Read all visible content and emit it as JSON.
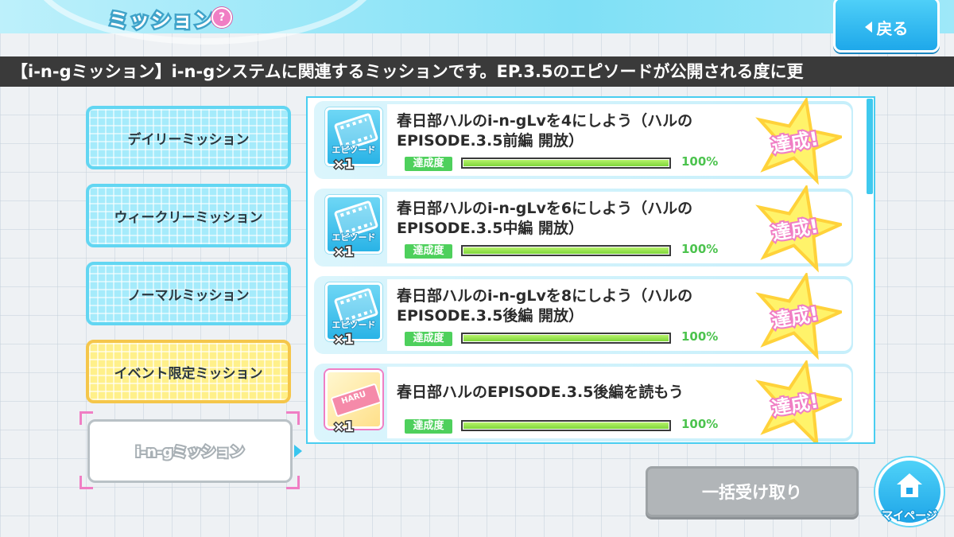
{
  "header": {
    "title": "ミッション",
    "help_label": "?",
    "back_label": "戻る"
  },
  "banner_text": "【i-n-gミッション】i-n-gシステムに関連するミッションです。EP.3.5のエピソードが公開される度に更",
  "tabs": [
    {
      "label": "デイリーミッション",
      "style": "blue"
    },
    {
      "label": "ウィークリーミッション",
      "style": "blue"
    },
    {
      "label": "ノーマルミッション",
      "style": "blue"
    },
    {
      "label": "イベント限定ミッション",
      "style": "yellow"
    },
    {
      "label": "i-n-gミッション",
      "style": "active"
    }
  ],
  "missions": [
    {
      "text": "春日部ハルのi-n-gLvを4にしよう（ハルのEPISODE.3.5前編 開放）",
      "reward_icon": "episode-film-icon",
      "reward_label": "エピソード",
      "qty": "×1",
      "progress_label": "達成度",
      "progress": 100,
      "progress_text": "100%",
      "stamp": "達成!"
    },
    {
      "text": "春日部ハルのi-n-gLvを6にしよう（ハルのEPISODE.3.5中編 開放）",
      "reward_icon": "episode-film-icon",
      "reward_label": "エピソード",
      "qty": "×1",
      "progress_label": "達成度",
      "progress": 100,
      "progress_text": "100%",
      "stamp": "達成!"
    },
    {
      "text": "春日部ハルのi-n-gLvを8にしよう（ハルのEPISODE.3.5後編 開放）",
      "reward_icon": "episode-film-icon",
      "reward_label": "エピソード",
      "qty": "×1",
      "progress_label": "達成度",
      "progress": 100,
      "progress_text": "100%",
      "stamp": "達成!"
    },
    {
      "text": "春日部ハルのEPISODE.3.5後編を読もう",
      "reward_icon": "haru-ticket-icon",
      "reward_label": "HARU",
      "qty": "×1",
      "progress_label": "達成度",
      "progress": 100,
      "progress_text": "100%",
      "stamp": "達成!"
    }
  ],
  "claim_all_label": "一括受け取り",
  "mypage_label": "マイページ",
  "colors": {
    "accent": "#1ea8ea",
    "progress": "#7ed63a",
    "stamp_pink": "#f07ec4",
    "stamp_yellow": "#fff36a"
  }
}
